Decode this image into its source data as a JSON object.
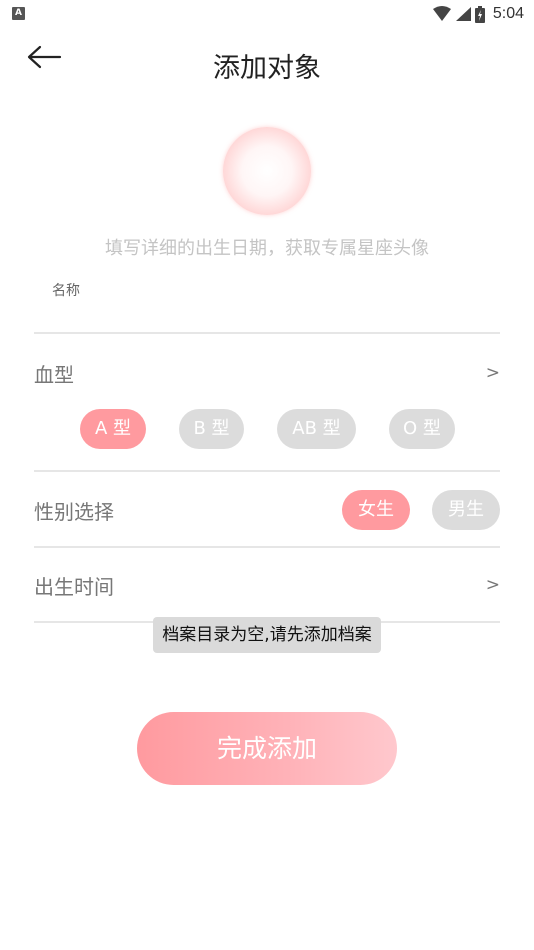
{
  "status_bar": {
    "app_badge": "A",
    "time": "5:04"
  },
  "header": {
    "title": "添加对象"
  },
  "profile": {
    "hint": "填写详细的出生日期，获取专属星座头像"
  },
  "name_field": {
    "label": "名称",
    "value": "",
    "placeholder": ""
  },
  "blood_type": {
    "label": "血型",
    "arrow": ">",
    "options": [
      "A 型",
      "B 型",
      "AB 型",
      "O 型"
    ],
    "selected": "A 型"
  },
  "gender": {
    "label": "性别选择",
    "options": [
      "女生",
      "男生"
    ],
    "selected": "女生"
  },
  "birth_time": {
    "label": "出生时间",
    "arrow": ">"
  },
  "toast": {
    "message": "档案目录为空,请先添加档案"
  },
  "submit": {
    "label": "完成添加"
  },
  "colors": {
    "accent": "#ff9a9f",
    "inactive": "#dcdcdc",
    "hint_text": "#c4c4c4"
  }
}
